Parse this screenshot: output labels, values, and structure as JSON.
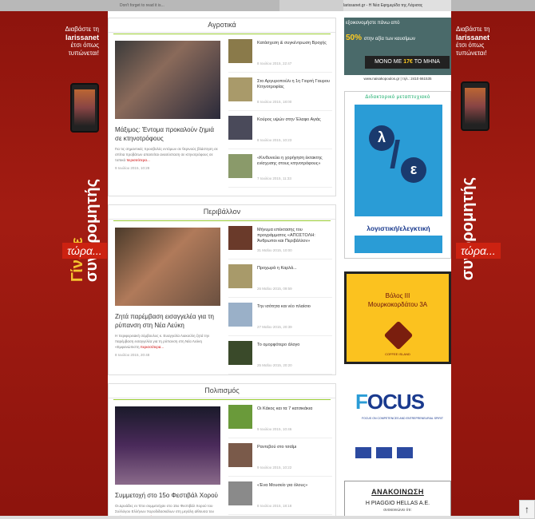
{
  "topbar": {
    "left_text": "Don't forget to read it is...",
    "right_text": "larissanet.gr - Η Νέα Εφημερίδα της Λάρισας"
  },
  "left_banner": {
    "line1": "Διαβάστε τη",
    "brand": "larissanet",
    "line3": "έτσι όπως",
    "line4": "τυπώνεται!",
    "vertical_top": "Γίνετε",
    "vertical_bottom": "συνδρομητής",
    "cta": "τώρα..."
  },
  "right_banner": {
    "line1": "Διαβάστε τη",
    "brand": "larissanet",
    "line3": "έτσι όπως",
    "line4": "τυπώνεται!",
    "vertical_bottom": "συνδρομητής",
    "cta": "τώρα..."
  },
  "sections": [
    {
      "title": "Αγροτικά",
      "lead": {
        "headline": "Μάξιμος: Έντομα προκαλούν ζημιά σε κτηνοτρόφους",
        "text": "Για τις σημαντικές προσβολές εντόμων σε θερινούς βλάστηση σε σπίτια προβάτων απαιτείται ανασύσταση σε κτηνοτρόφους σε τοπικά",
        "more": "περισσότερα...",
        "date": "9 Ιουλίου 2015, 10:28"
      },
      "items": [
        {
          "title": "Κατάσχεση & συγκέντρωση Βροχής",
          "date": "8 Ιουλίου 2015, 22:47"
        },
        {
          "title": "Στο Αργυροπούλι η 1η Γιορτή Γαυρου Κτηνοτροφίας",
          "date": "8 Ιουλίου 2015, 18:00"
        },
        {
          "title": "Κούρος υψών στην Έλαφο Αγιάς",
          "date": "8 Ιουλίου 2015, 10:23"
        },
        {
          "title": "«Κινδυνεύει η χορήγηση έκτακτης ενίσχυσης στους κτηνοτρόφους»",
          "date": "7 Ιουλίου 2015, 11:33"
        }
      ]
    },
    {
      "title": "Περιβάλλον",
      "lead": {
        "headline": "Ζητά παρέμβαση εισαγγελέα για τη ρύπανση στη Νέα Λεύκη",
        "text": "Η περιφερειακή σύμβουλος κ. Ευαγγελία Λιακούλη ζητά την παρέμβαση εισαγγελέα για τη ρύπανση στη Νέα Λεύκη «Εμφανώπιστη",
        "more": "περισσότερα...",
        "date": "8 Ιουλίου 2015, 20:48"
      },
      "items": [
        {
          "title": "Μήνυμα επέκτασης του προγράμματος «ΑΠΟΣΤΟΛΗ: Άνθρωποι και Περιβάλλον»",
          "date": "31 Μαΐου 2015, 10:00"
        },
        {
          "title": "Προχωρά η Καρλά...",
          "date": "26 Μαΐου 2015, 09:59"
        },
        {
          "title": "Την ισότητα και νέο πλαίσιο",
          "date": "27 Μαΐου 2015, 20:39"
        },
        {
          "title": "Το ομορφότερο άλογο",
          "date": "25 Μαΐου 2015, 20:20"
        }
      ]
    },
    {
      "title": "Πολιτισμός",
      "lead": {
        "headline": "Συμμετοχή στο 15ο Φεστιβάλ Χορού",
        "text": "Οι Δρυάδες εν Έτει συμμετείχαν στο 15ο Φεστιβάλ Χορού του Συλλόγου Ελλήνων Χοροδιδασκάλων στη μεγάλη αίθουσα του Θεάτρου και η",
        "more": "περισσότερα...",
        "date": ""
      },
      "items": [
        {
          "title": "Οι Κάκος και τα 7 κατσικάκια",
          "date": "9 Ιουλίου 2015, 10:46"
        },
        {
          "title": "Ραντεβού στο τσαΐμι",
          "date": "9 Ιουλίου 2015, 10:22"
        },
        {
          "title": "«Ένα Μουσείο για όλους»",
          "date": "8 Ιουλίου 2015, 18:18"
        }
      ]
    }
  ],
  "ads": {
    "ad1_line1": "εξοικονομήστε πάνω από",
    "ad1_percent": "50%",
    "ad1_line2": "στην αξία των καυσίμων",
    "ad1_price_pre": "ΜΟΝΟ ΜΕ",
    "ad1_price": "17€",
    "ad1_price_post": "ΤΟ ΜΗΝΑ",
    "ad1_web": "www.naisakopoulos.gr | τηλ.: 2410 661535",
    "ad2_head": "Διδακτορικό μεταπτυχιακό",
    "ad2_letter1": "λ",
    "ad2_letter2": "ε",
    "ad2_label": "λογιστική/ελεγκτική",
    "ad3_line1": "Βόλος ΙΙΙ",
    "ad3_line2": "Μουρκοκορδάτου 3Α",
    "ad3_brand": "COFFEE ISLAND",
    "ad4_f": "F",
    "ad4_ocus": "OCUS",
    "ad4_sub": "FOCUS ON COMPETENCES AND ENTREPRENEURIAL SPIRIT",
    "ad5_title": "ΑΝΑΚΟΙΝΩΣΗ",
    "ad5_company": "Η PIAGGIO HELLAS A.E.",
    "ad5_sub": "ανακοινώνει ότι:"
  },
  "scrolltop_icon": "↑"
}
